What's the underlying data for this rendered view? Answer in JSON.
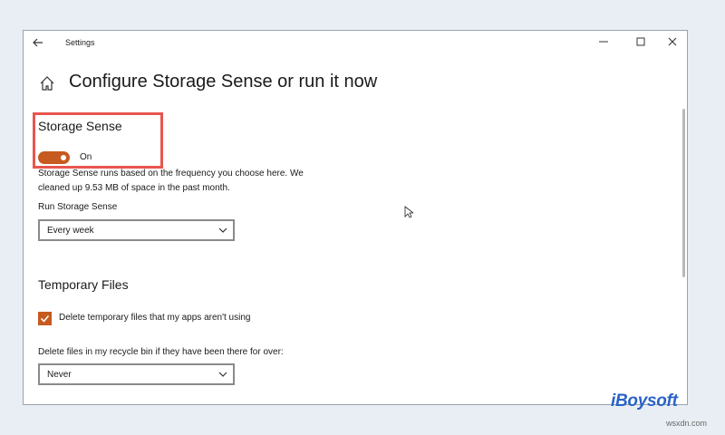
{
  "window": {
    "title": "Settings",
    "controls": [
      "minimize-icon",
      "maximize-icon",
      "close-icon"
    ]
  },
  "page": {
    "title": "Configure Storage Sense or run it now"
  },
  "storage_sense": {
    "heading": "Storage Sense",
    "toggle_state": "On",
    "toggle_on": true,
    "description": "Storage Sense runs based on the frequency you choose here. We cleaned up 9.53 MB of space in the past month.",
    "run_label": "Run Storage Sense",
    "run_value": "Every week"
  },
  "temporary_files": {
    "heading": "Temporary Files",
    "checkbox_label": "Delete temporary files that my apps aren't using",
    "checkbox_checked": true,
    "recycle_label": "Delete files in my recycle bin if they have been there for over:",
    "recycle_value": "Never"
  },
  "colors": {
    "accent": "#c75a1f",
    "highlight_border": "#e8554e",
    "logo": "#2a63c7"
  },
  "branding": {
    "logo": "iBoysoft",
    "watermark": "wsxdn.com"
  }
}
